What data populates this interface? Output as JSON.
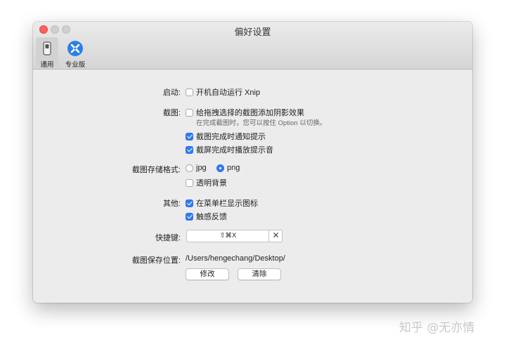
{
  "window": {
    "title": "偏好设置"
  },
  "toolbar": {
    "general_label": "通用",
    "pro_label": "专业版",
    "general_icon": "switch-icon",
    "pro_icon": "tools-icon"
  },
  "settings": {
    "startup": {
      "label": "启动:",
      "option": "开机自动运行 Xnip",
      "checked": false
    },
    "screenshot": {
      "label": "截图:",
      "shadow_option": "给拖拽选择的截图添加阴影效果",
      "shadow_checked": false,
      "shadow_hint": "在完成截图时，您可以按住 Option 以切换。",
      "notify_option": "截图完成时通知提示",
      "notify_checked": true,
      "sound_option": "截屏完成时播放提示音",
      "sound_checked": true
    },
    "format": {
      "label": "截图存储格式:",
      "jpg": "jpg",
      "png": "png",
      "selected": "png",
      "transparent_option": "透明背景",
      "transparent_checked": false
    },
    "other": {
      "label": "其他:",
      "menubar_option": "在菜单栏显示图标",
      "menubar_checked": true,
      "haptic_option": "触感反馈",
      "haptic_checked": true
    },
    "shortcut": {
      "label": "快捷键:",
      "value": "⇧⌘X",
      "clear": "✕"
    },
    "save_location": {
      "label": "截图保存位置:",
      "path": "/Users/hengechang/Desktop/",
      "modify_button": "修改",
      "clear_button": "清除"
    }
  },
  "watermark": "知乎 @无亦情",
  "colors": {
    "accent": "#2f7cf6",
    "close": "#fc605c"
  }
}
